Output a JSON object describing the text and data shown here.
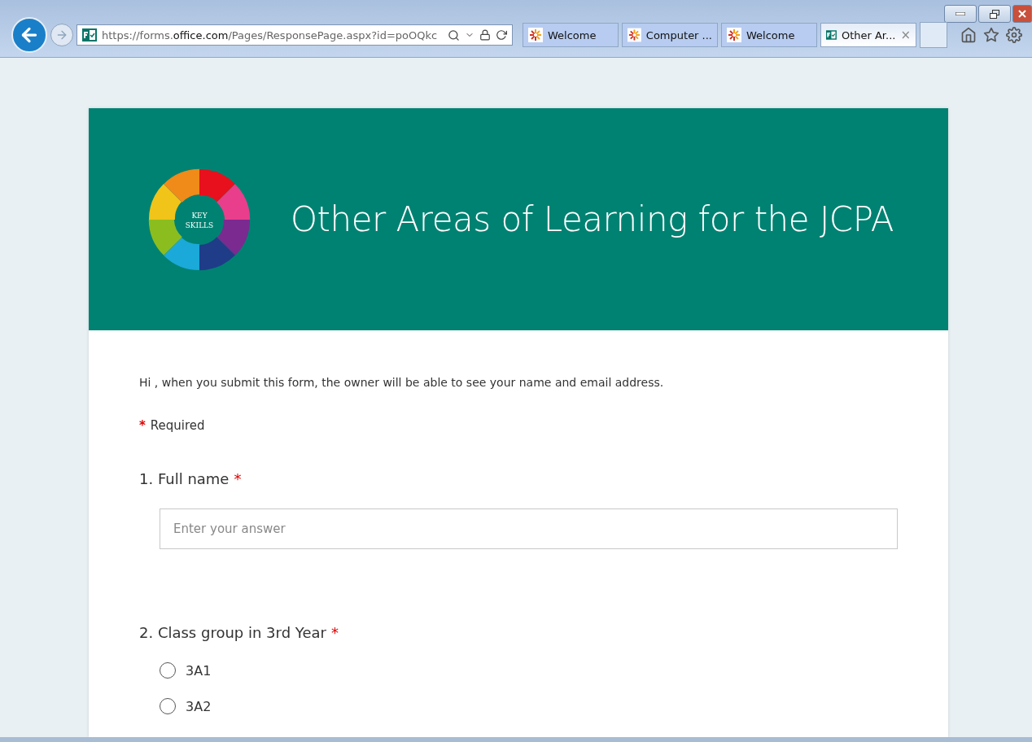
{
  "browser": {
    "url_host_prefix": "https://forms.",
    "url_host": "office.com",
    "url_path": "/Pages/ResponsePage.aspx?id=poOQkc",
    "tabs": [
      {
        "label": "Welcome",
        "kind": "site",
        "selected": false
      },
      {
        "label": "Computer ...",
        "kind": "site",
        "selected": false
      },
      {
        "label": "Welcome",
        "kind": "site",
        "selected": false
      },
      {
        "label": "Other Ar...",
        "kind": "forms",
        "selected": true,
        "close": "×"
      }
    ]
  },
  "header": {
    "logo_text": [
      "KEY",
      "SKILLS"
    ],
    "title": "Other Areas of Learning for the JCPA"
  },
  "notice": "Hi , when you submit this form, the owner will be able to see your name and email address.",
  "required_mark": "*",
  "required_label": "Required",
  "questions": [
    {
      "kind": "text",
      "label": "1. Full name",
      "required": true,
      "placeholder": "Enter your answer"
    },
    {
      "kind": "choice",
      "label": "2. Class group in 3rd Year",
      "required": true,
      "options": [
        {
          "label": "3A1",
          "selected": false
        },
        {
          "label": "3A2",
          "selected": false
        }
      ]
    }
  ]
}
